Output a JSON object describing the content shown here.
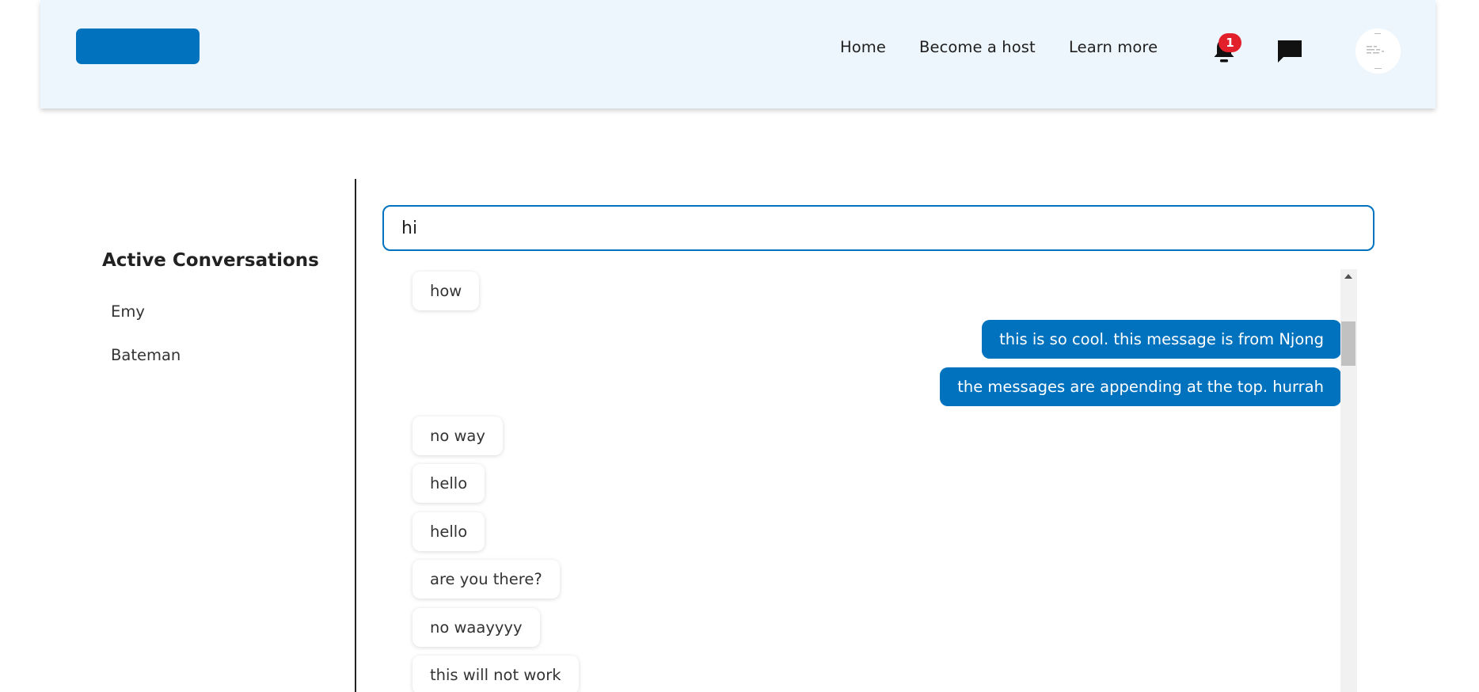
{
  "nav": {
    "links": [
      "Home",
      "Become a host",
      "Learn more"
    ],
    "notification_count": "1"
  },
  "sidebar": {
    "title": "Active Conversations",
    "conversations": [
      "Emy",
      "Bateman"
    ]
  },
  "composer": {
    "value": "hi"
  },
  "messages": [
    {
      "text": "how",
      "direction": "incoming"
    },
    {
      "text": "this is so cool. this message is from Njong",
      "direction": "outgoing"
    },
    {
      "text": "the messages are appending at the top. hurrah",
      "direction": "outgoing"
    },
    {
      "text": "no way",
      "direction": "incoming"
    },
    {
      "text": "hello",
      "direction": "incoming"
    },
    {
      "text": "hello",
      "direction": "incoming"
    },
    {
      "text": "are you there?",
      "direction": "incoming"
    },
    {
      "text": "no waayyyy",
      "direction": "incoming"
    },
    {
      "text": "this will not work",
      "direction": "incoming"
    }
  ],
  "colors": {
    "brand": "#0172bd",
    "navbar_bg": "#eef6fd",
    "badge": "#e2202c"
  },
  "icons": [
    "bell-icon",
    "chat-icon",
    "avatar"
  ]
}
